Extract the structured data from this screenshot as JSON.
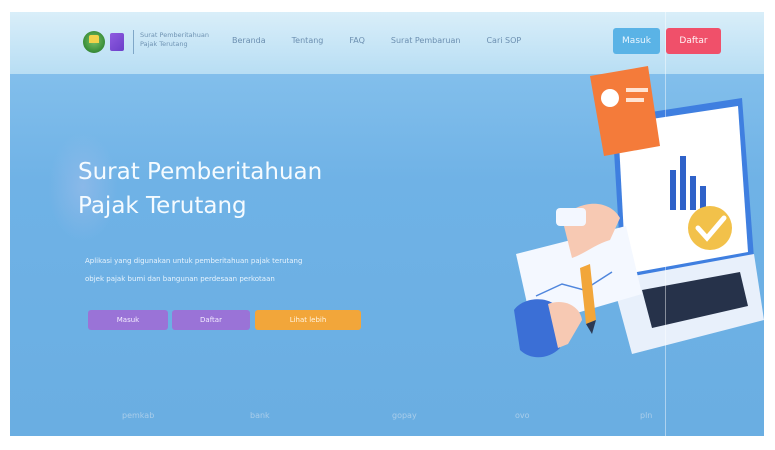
{
  "brand": {
    "line1": "Surat Pemberitahuan",
    "line2": "Pajak Terutang"
  },
  "nav": {
    "links": [
      "Beranda",
      "Tentang",
      "FAQ",
      "Surat Pembaruan",
      "Cari SOP"
    ],
    "masuk": "Masuk",
    "daftar": "Daftar"
  },
  "hero": {
    "title_line1": "Surat Pemberitahuan",
    "title_line2": "Pajak Terutang",
    "desc_line1": "Aplikasi yang digunakan untuk pemberitahuan pajak terutang",
    "desc_line2": "objek pajak bumi dan bangunan perdesaan perkotaan",
    "buttons": {
      "masuk": "Masuk",
      "daftar": "Daftar",
      "lihat": "Lihat lebih"
    }
  },
  "partners": [
    "pemkab",
    "bank",
    "gopay",
    "ovo",
    "pln"
  ],
  "colors": {
    "navbar": "#c7e6f7",
    "hero_bg": "#6fb2e6",
    "masuk_top": "#5ab3e6",
    "daftar_top": "#f0506a",
    "purple_btn": "#9a73d7",
    "orange_btn": "#f2a63a"
  },
  "icons": [
    "regency-emblem-icon",
    "app-logo-icon",
    "laptop-chart-illustration",
    "hand-icon",
    "pencil-icon",
    "check-badge-icon",
    "flame-card-icon"
  ]
}
